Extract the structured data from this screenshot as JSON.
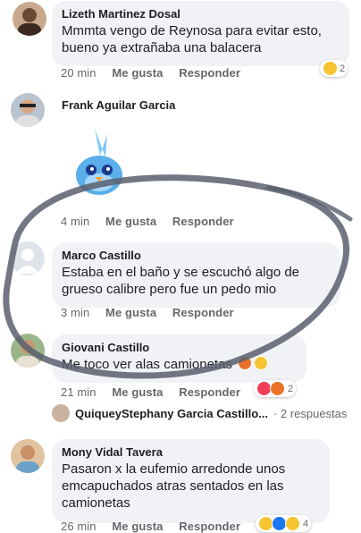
{
  "comments": [
    {
      "name": "Lizeth Martinez Dosal",
      "lines": [
        "Mmmta vengo de Reynosa para evitar esto,",
        "bueno ya extrañaba una balacera"
      ],
      "time": "20 min",
      "like": "Me gusta",
      "reply": "Responder",
      "reaction_count": "2"
    },
    {
      "name": "Frank Aguilar Garcia",
      "time": "4 min",
      "like": "Me gusta",
      "reply": "Responder"
    },
    {
      "name": "Marco Castillo",
      "lines": [
        "Estaba en el baño y se escuchó algo de",
        "grueso calibre pero fue un pedo mio"
      ],
      "time": "3 min",
      "like": "Me gusta",
      "reply": "Responder"
    },
    {
      "name": "Giovani Castillo",
      "lines": [
        "Me toco ver alas camionetas"
      ],
      "time": "21 min",
      "like": "Me gusta",
      "reply": "Responder",
      "reaction_count": "2"
    },
    {
      "name": "Mony Vidal Tavera",
      "lines": [
        "Pasaron x la eufemio arredonde unos",
        "emcapuchados atras sentados en las",
        "camionetas"
      ],
      "time": "26 min",
      "like": "Me gusta",
      "reply": "Responder",
      "reaction_count": "4"
    }
  ],
  "replies_preview": {
    "names": "QuiqueyStephany Garcia Castillo...",
    "count": "· 2 respuestas"
  },
  "colors": {
    "bubble": "#f0f2f5",
    "meta": "#65676b",
    "ink_circle": "#5a5f6e"
  }
}
